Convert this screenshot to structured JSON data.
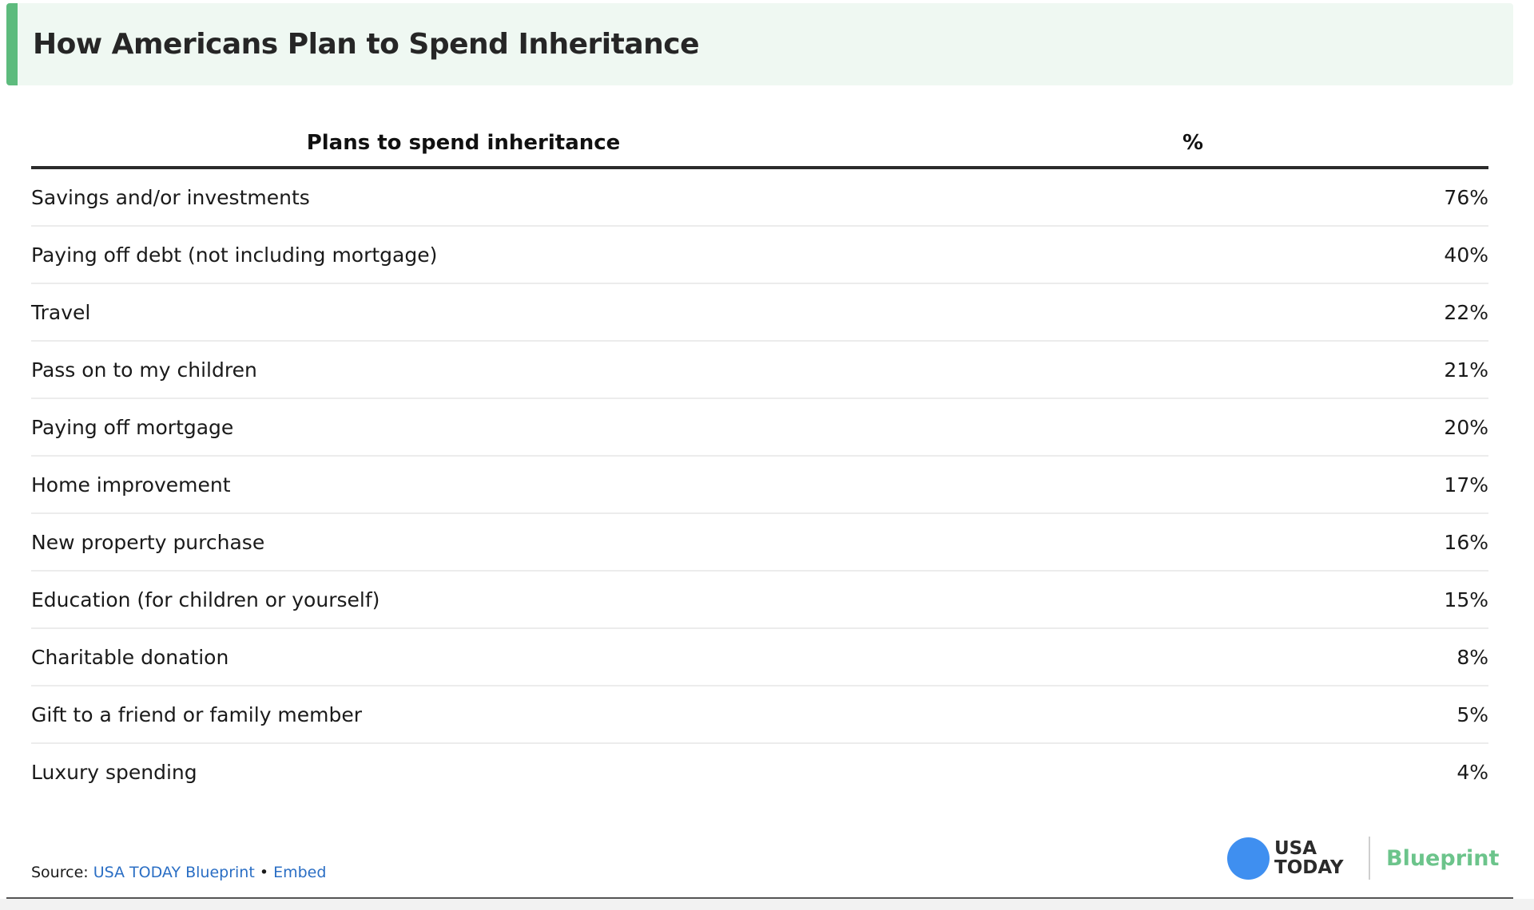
{
  "title": "How Americans Plan to Spend Inheritance",
  "chart_data": {
    "type": "table",
    "title": "How Americans Plan to Spend Inheritance",
    "columns": [
      "Plans to spend inheritance",
      "%"
    ],
    "rows": [
      {
        "plan": "Savings and/or investments",
        "pct": "76%"
      },
      {
        "plan": "Paying off debt (not including mortgage)",
        "pct": "40%"
      },
      {
        "plan": "Travel",
        "pct": "22%"
      },
      {
        "plan": "Pass on to my children",
        "pct": "21%"
      },
      {
        "plan": "Paying off mortgage",
        "pct": "20%"
      },
      {
        "plan": "Home improvement",
        "pct": "17%"
      },
      {
        "plan": "New property purchase",
        "pct": "16%"
      },
      {
        "plan": "Education (for children or yourself)",
        "pct": "15%"
      },
      {
        "plan": "Charitable donation",
        "pct": "8%"
      },
      {
        "plan": "Gift to a friend or family member",
        "pct": "5%"
      },
      {
        "plan": "Luxury spending",
        "pct": "4%"
      }
    ]
  },
  "footer": {
    "source_label": "Source: ",
    "source_link": "USA TODAY Blueprint",
    "bullet": " • ",
    "embed_link": "Embed"
  },
  "logo": {
    "usa_line1": "USA",
    "usa_line2": "TODAY",
    "blueprint": "Blueprint"
  },
  "colors": {
    "accent_green": "#5dbb7d",
    "title_bg": "#eff8f2",
    "link_blue": "#2a6ec4",
    "logo_dot": "#3f8ff0",
    "blueprint_green": "#6cc48b"
  }
}
